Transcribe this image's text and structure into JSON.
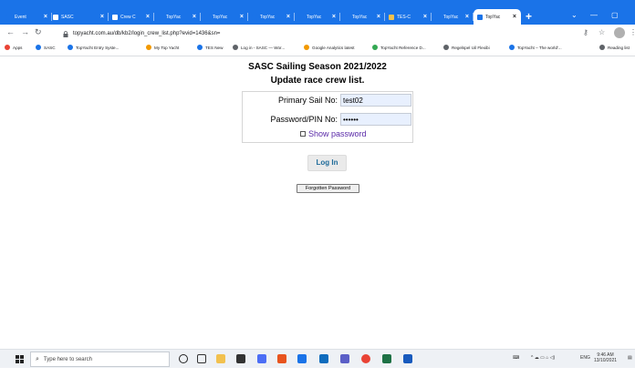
{
  "browser": {
    "tabs": [
      {
        "label": "Event"
      },
      {
        "label": "SASC"
      },
      {
        "label": "Crew C"
      },
      {
        "label": "TopYac"
      },
      {
        "label": "TopYac"
      },
      {
        "label": "TopYac"
      },
      {
        "label": "TopYac"
      },
      {
        "label": "TopYac"
      },
      {
        "label": "TES-C"
      },
      {
        "label": "TopYac"
      },
      {
        "label": "TopYac"
      }
    ],
    "url": "topyacht.com.au/db/kb2/login_crew_list.php?evid=1436&sn=",
    "bookmarks": [
      {
        "label": "Apps"
      },
      {
        "label": "SASC"
      },
      {
        "label": "TopYacht Entry Syste..."
      },
      {
        "label": "My Top Yacht"
      },
      {
        "label": "TES New"
      },
      {
        "label": "Log in - SASC — Wor..."
      },
      {
        "label": "Google Analytics latest"
      },
      {
        "label": "TopYacht Reference D..."
      },
      {
        "label": "Regelspel Uil Flexibi"
      },
      {
        "label": "TopYacht – The world'..."
      },
      {
        "label": "Reading list"
      }
    ]
  },
  "page": {
    "title": "SASC Sailing Season 2021/2022",
    "subtitle": "Update race crew list.",
    "form": {
      "sail_label": "Primary Sail No:",
      "sail_value": "test02",
      "pin_label": "Password/PIN No:",
      "pin_value": "••••••",
      "show_password_label": "Show password"
    },
    "login_button": "Log In",
    "forgot_button": "Forgotten Password"
  },
  "taskbar": {
    "search_placeholder": "Type here to search",
    "language": "ENG",
    "time": "9:46 AM",
    "date": "13/10/2021"
  },
  "colors": {
    "tab_strip": "#1a73e8",
    "input_autofill": "#e8f0fe",
    "show_password": "#5a2aa8",
    "login_text": "#1f6b9a"
  }
}
